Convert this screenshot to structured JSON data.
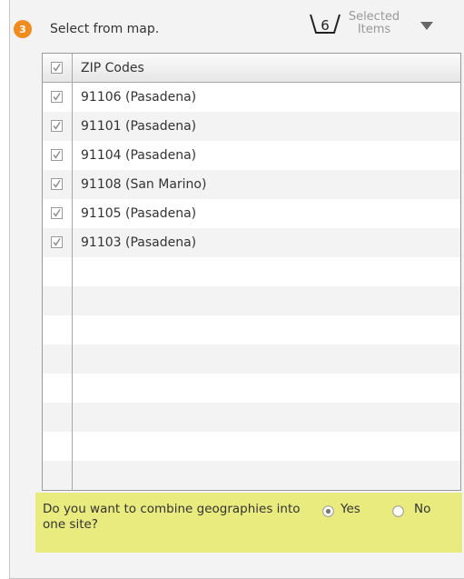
{
  "header": {
    "step_number": "3",
    "title": "Select from map.",
    "selected_count": "6",
    "selected_label_line1": "Selected",
    "selected_label_line2": "Items"
  },
  "table": {
    "column_header": "ZIP Codes",
    "header_checked": true,
    "rows": [
      {
        "label": "91106 (Pasadena)",
        "checked": true
      },
      {
        "label": "91101 (Pasadena)",
        "checked": true
      },
      {
        "label": "91104 (Pasadena)",
        "checked": true
      },
      {
        "label": "91108 (San Marino)",
        "checked": true
      },
      {
        "label": "91105 (Pasadena)",
        "checked": true
      },
      {
        "label": "91103 (Pasadena)",
        "checked": true
      },
      {
        "label": "",
        "checked": false
      },
      {
        "label": "",
        "checked": false
      },
      {
        "label": "",
        "checked": false
      },
      {
        "label": "",
        "checked": false
      },
      {
        "label": "",
        "checked": false
      },
      {
        "label": "",
        "checked": false
      },
      {
        "label": "",
        "checked": false
      },
      {
        "label": "",
        "checked": false
      }
    ]
  },
  "combine": {
    "question": "Do you want to combine geographies into one site?",
    "yes_label": "Yes",
    "no_label": "No",
    "selected": "Yes"
  },
  "colors": {
    "step_badge": "#f08c1e",
    "combine_background": "#eaeb7f",
    "panel_background": "#f3f3f3"
  }
}
